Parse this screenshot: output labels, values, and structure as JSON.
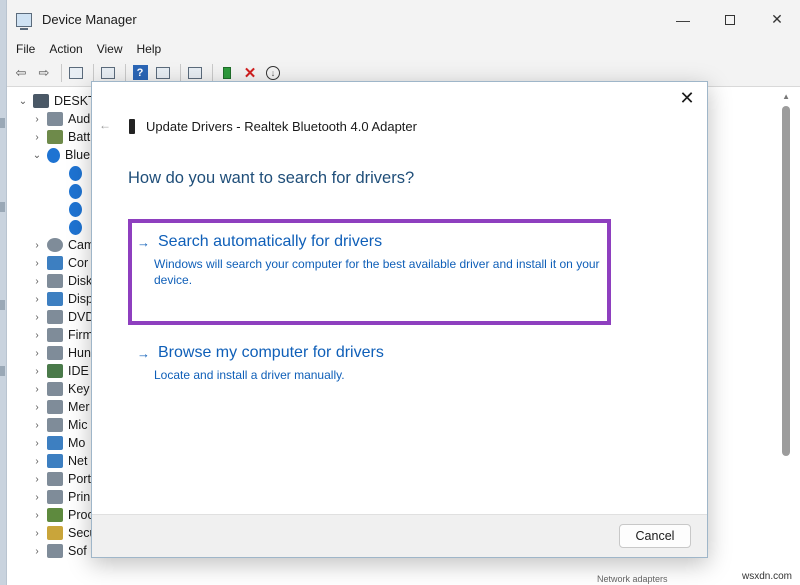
{
  "window": {
    "title": "Device Manager",
    "minimize_glyph": "—",
    "close_glyph": "✕"
  },
  "menubar": {
    "items": [
      "File",
      "Action",
      "View",
      "Help"
    ]
  },
  "toolbar": {
    "back_glyph": "⇦",
    "forward_glyph": "⇨",
    "qm_glyph": "?",
    "remove_glyph": "✕",
    "update_glyph": "↓",
    "icons": [
      "back-arrow-icon",
      "forward-arrow-icon",
      "properties-icon",
      "computer-icon",
      "help-icon",
      "scan-icon",
      "monitor-icon",
      "update-driver-icon",
      "uninstall-icon",
      "disable-icon"
    ]
  },
  "tree": {
    "root": "DESKTO",
    "bluetooth": "Blue",
    "items": [
      "Aud",
      "Batt",
      "Cam",
      "Cor",
      "Disk",
      "Disp",
      "DVD",
      "Firm",
      "Hun",
      "IDE",
      "Key",
      "Mer",
      "Mic",
      "Mo",
      "Net",
      "Port",
      "Prin",
      "Proc",
      "Secu",
      "Sof"
    ],
    "expanded_glyph": "⌄",
    "collapsed_glyph": "›"
  },
  "dialog": {
    "back_glyph": "←",
    "close_glyph": "✕",
    "title": "Update Drivers - Realtek Bluetooth 4.0 Adapter",
    "question": "How do you want to search for drivers?",
    "option_arrow": "→",
    "option1": {
      "title": "Search automatically for drivers",
      "description": "Windows will search your computer for the best available driver and install it on your device."
    },
    "option2": {
      "title": "Browse my computer for drivers",
      "description": "Locate and install a driver manually."
    },
    "cancel_label": "Cancel"
  },
  "status": {
    "footer_fragment": "Network adapters"
  },
  "watermark": "wsxdn.com",
  "colors": {
    "link": "#0f5fb8",
    "heading": "#1f4e79",
    "highlight_border": "#8e3fbf",
    "bluetooth": "#1e73d2"
  }
}
